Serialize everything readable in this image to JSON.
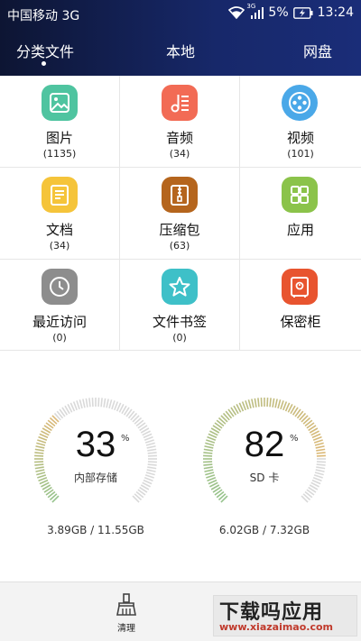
{
  "status": {
    "carrier": "中国移动 3G",
    "battery": "5%",
    "time": "13:24",
    "net_badge": "3G"
  },
  "tabs": [
    {
      "label": "分类文件",
      "active": true
    },
    {
      "label": "本地",
      "active": false
    },
    {
      "label": "网盘",
      "active": false
    }
  ],
  "categories": [
    {
      "name": "图片",
      "count": "(1135)",
      "icon": "image-icon",
      "color": "#4fc4a0"
    },
    {
      "name": "音频",
      "count": "(34)",
      "icon": "music-icon",
      "color": "#f26b55"
    },
    {
      "name": "视频",
      "count": "(101)",
      "icon": "film-reel-icon",
      "color": "#4aa8e8"
    },
    {
      "name": "文档",
      "count": "(34)",
      "icon": "document-icon",
      "color": "#f5c43a"
    },
    {
      "name": "压缩包",
      "count": "(63)",
      "icon": "zip-icon",
      "color": "#b5651d"
    },
    {
      "name": "应用",
      "count": "",
      "icon": "apps-icon",
      "color": "#8bc34a"
    },
    {
      "name": "最近访问",
      "count": "(0)",
      "icon": "clock-icon",
      "color": "#8d8d8d"
    },
    {
      "name": "文件书签",
      "count": "(0)",
      "icon": "star-icon",
      "color": "#3ec0c8"
    },
    {
      "name": "保密柜",
      "count": "",
      "icon": "safe-icon",
      "color": "#e8542f"
    }
  ],
  "storage": {
    "internal": {
      "percent": "33",
      "unit": "%",
      "label": "内部存储",
      "size": "3.89GB / 11.55GB",
      "fraction": 0.33
    },
    "sd": {
      "percent": "82",
      "unit": "%",
      "label": "SD 卡",
      "size": "6.02GB / 7.32GB",
      "fraction": 0.82
    }
  },
  "bottom": {
    "clean_label": "清理",
    "watermark_main": "下载吗应用",
    "watermark_url": "www.xiazaimao.com"
  }
}
